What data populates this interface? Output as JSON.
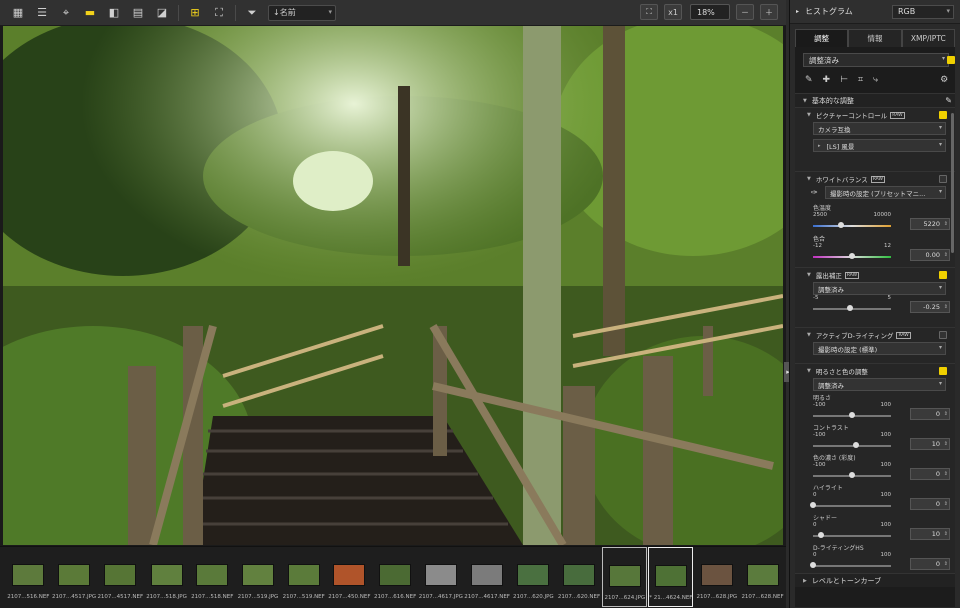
{
  "toolbar": {
    "sort_label": "名前",
    "zoom_fit_label": "x1",
    "zoom_percent": "18%"
  },
  "filmstrip": [
    {
      "name": "2107...516.NEF",
      "color": "#5d7a3c"
    },
    {
      "name": "2107...4517.JPG",
      "color": "#5b7a38"
    },
    {
      "name": "2107...4517.NEF",
      "color": "#567535"
    },
    {
      "name": "2107...518.JPG",
      "color": "#60803e"
    },
    {
      "name": "2107...518.NEF",
      "color": "#5a7a3a"
    },
    {
      "name": "2107...519.JPG",
      "color": "#62813f"
    },
    {
      "name": "2107...519.NEF",
      "color": "#5b7b3a"
    },
    {
      "name": "2107...450.NEF",
      "color": "#b0542a"
    },
    {
      "name": "2107...616.NEF",
      "color": "#4b6a33"
    },
    {
      "name": "2107...4617.JPG",
      "color": "#8b8b8b"
    },
    {
      "name": "2107...4617.NEF",
      "color": "#7b7b7b"
    },
    {
      "name": "2107...620.JPG",
      "color": "#4a7040"
    },
    {
      "name": "2107...620.NEF",
      "color": "#486c3d"
    },
    {
      "name": "2107...624.JPG",
      "color": "#57773a"
    },
    {
      "name": "* 21...4624.NEF",
      "color": "#4e7135"
    },
    {
      "name": "2107...628.JPG",
      "color": "#6b5340"
    },
    {
      "name": "2107...628.NEF",
      "color": "#5b7b3d"
    }
  ],
  "panel": {
    "histogram_label": "ヒストグラム",
    "histogram_mode": "RGB",
    "tabs": [
      "調整",
      "情報",
      "XMP/IPTC"
    ],
    "preset": "調整済み",
    "basic_section": "基本的な調整",
    "picture_control": {
      "title": "ピクチャーコントロール",
      "raw": "RAW",
      "mode": "カメラ互換",
      "value": "[LS] 風景"
    },
    "white_balance": {
      "title": "ホワイトバランス",
      "raw": "RAW",
      "setting": "撮影時の設定 (プリセットマニ...",
      "temp_label": "色温度",
      "temp_min": "2500",
      "temp_max": "10000",
      "temp_value": "5220",
      "temp_level": 0.36,
      "tint_label": "色合",
      "tint_min": "-12",
      "tint_max": "12",
      "tint_value": "0.00",
      "tint_level": 0.5
    },
    "exposure": {
      "title": "露出補正",
      "raw": "RAW",
      "setting": "調整済み",
      "min": "-5",
      "max": "5",
      "value": "-0.25",
      "level": 0.48
    },
    "adl": {
      "title": "アクティブD-ライティング",
      "raw": "RAW",
      "setting": "撮影時の設定 (標準)"
    },
    "brightness_color": {
      "title": "明るさと色の調整",
      "setting": "調整済み",
      "rows": [
        {
          "label": "明るさ",
          "min": "-100",
          "max": "100",
          "value": "0",
          "level": 0.5
        },
        {
          "label": "コントラスト",
          "min": "-100",
          "max": "100",
          "value": "10",
          "level": 0.55
        },
        {
          "label": "色の濃さ (彩度)",
          "min": "-100",
          "max": "100",
          "value": "0",
          "level": 0.5
        },
        {
          "label": "ハイライト",
          "min": "0",
          "max": "100",
          "value": "0",
          "level": 0.0
        },
        {
          "label": "シャドー",
          "min": "0",
          "max": "100",
          "value": "10",
          "level": 0.1
        },
        {
          "label": "D-ライティングHS",
          "min": "0",
          "max": "100",
          "value": "0",
          "level": 0.0
        }
      ]
    },
    "levels_section": "レベルとトーンカーブ"
  }
}
